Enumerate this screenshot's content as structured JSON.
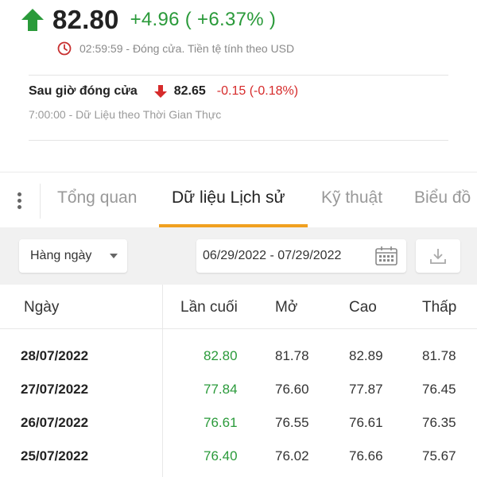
{
  "quote": {
    "price": "82.80",
    "change": "+4.96 ( +6.37% )",
    "close_info": "02:59:59 - Đóng cửa. Tiền tệ tính theo USD",
    "after_hours": {
      "label": "Sau giờ đóng cửa",
      "price": "82.65",
      "change": "-0.15 (-0.18%)",
      "sub": "7:00:00 - Dữ Liệu theo Thời Gian Thực"
    },
    "colors": {
      "up": "#2a9a3a",
      "down": "#d62b2b"
    }
  },
  "tabs": [
    {
      "label": "Tổng quan"
    },
    {
      "label": "Dữ liệu Lịch sử",
      "active": true
    },
    {
      "label": "Kỹ thuật"
    },
    {
      "label": "Biểu đồ"
    }
  ],
  "filters": {
    "period": "Hàng ngày",
    "date_range": "06/29/2022 - 07/29/2022"
  },
  "table": {
    "columns": [
      "Ngày",
      "Lần cuối",
      "Mở",
      "Cao",
      "Thấp"
    ],
    "rows": [
      {
        "date": "28/07/2022",
        "last": "82.80",
        "open": "81.78",
        "high": "82.89",
        "low": "81.78"
      },
      {
        "date": "27/07/2022",
        "last": "77.84",
        "open": "76.60",
        "high": "77.87",
        "low": "76.45"
      },
      {
        "date": "26/07/2022",
        "last": "76.61",
        "open": "76.55",
        "high": "76.61",
        "low": "76.35"
      },
      {
        "date": "25/07/2022",
        "last": "76.40",
        "open": "76.02",
        "high": "76.66",
        "low": "75.67"
      }
    ]
  },
  "icons": {
    "price_direction": "arrow-up-icon",
    "close_time": "clock-icon",
    "after_hours_direction": "arrow-down-icon",
    "more": "more-vertical-icon",
    "period_caret": "chevron-down-icon",
    "calendar": "calendar-icon",
    "download": "download-icon"
  },
  "accent_color": "#f0a020"
}
